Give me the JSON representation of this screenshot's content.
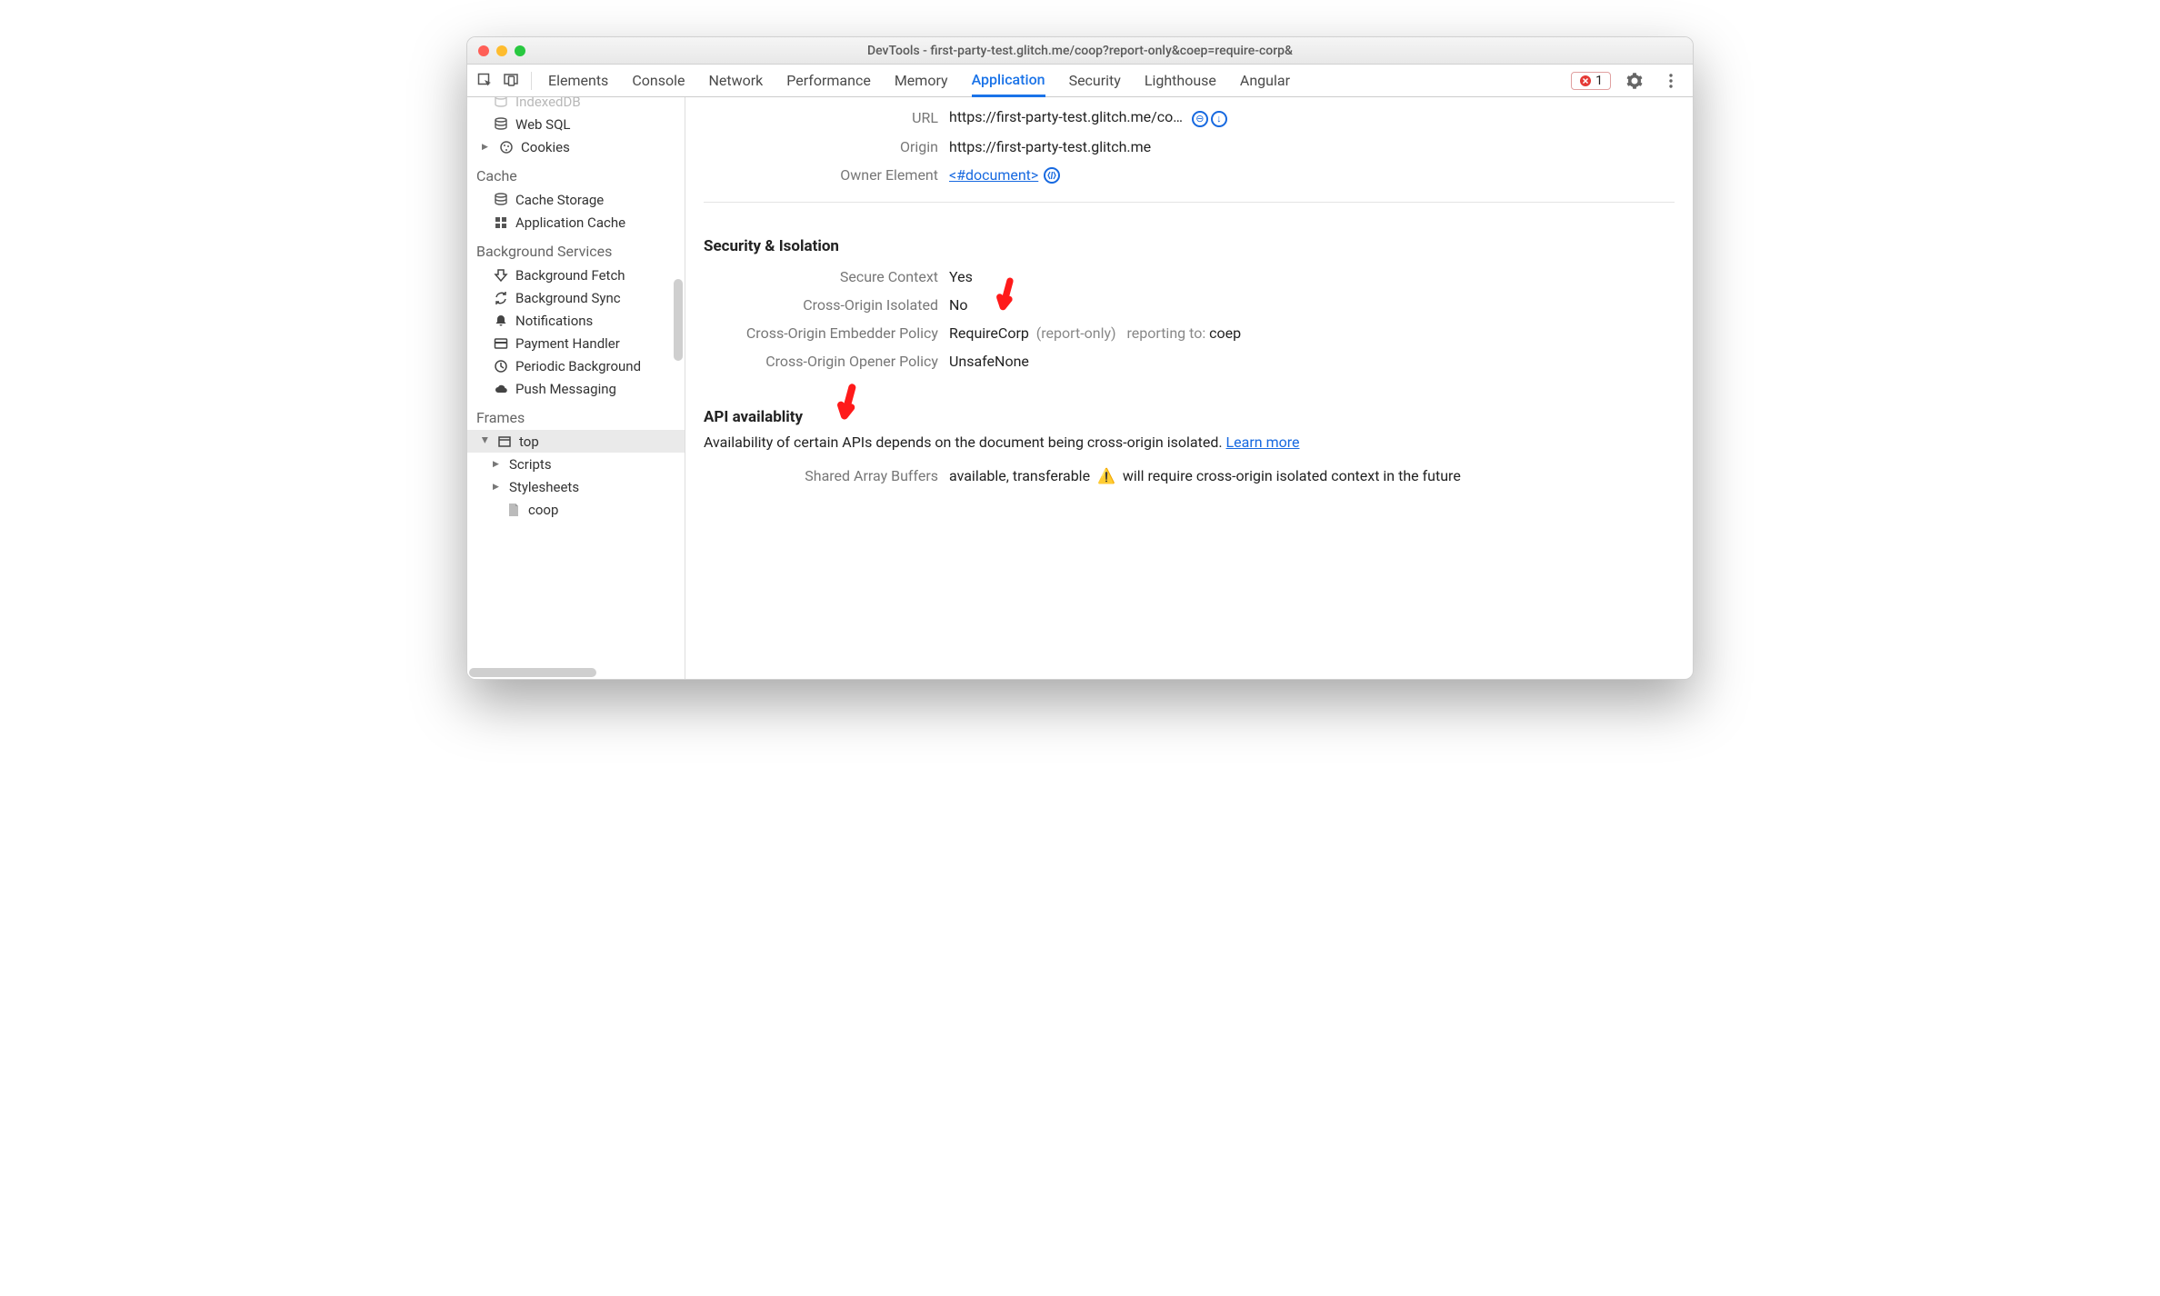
{
  "window": {
    "title": "DevTools - first-party-test.glitch.me/coop?report-only&coep=require-corp&"
  },
  "tabs": {
    "items": [
      "Elements",
      "Console",
      "Network",
      "Performance",
      "Memory",
      "Application",
      "Security",
      "Lighthouse",
      "Angular"
    ],
    "active": "Application"
  },
  "error_count": "1",
  "sidebar": {
    "indexeddb": "IndexedDB",
    "websql": "Web SQL",
    "cookies": "Cookies",
    "cache_header": "Cache",
    "cache_storage": "Cache Storage",
    "app_cache": "Application Cache",
    "bg_header": "Background Services",
    "bg_fetch": "Background Fetch",
    "bg_sync": "Background Sync",
    "notif": "Notifications",
    "payment": "Payment Handler",
    "periodic": "Periodic Background",
    "push": "Push Messaging",
    "frames_header": "Frames",
    "top": "top",
    "scripts": "Scripts",
    "stylesheets": "Stylesheets",
    "coop": "coop"
  },
  "main": {
    "url_label": "URL",
    "url_value": "https://first-party-test.glitch.me/co…",
    "origin_label": "Origin",
    "origin_value": "https://first-party-test.glitch.me",
    "owner_label": "Owner Element",
    "owner_value": "<#document>",
    "sec_heading": "Security & Isolation",
    "secure_ctx_label": "Secure Context",
    "secure_ctx_value": "Yes",
    "coi_label": "Cross-Origin Isolated",
    "coi_value": "No",
    "coep_label": "Cross-Origin Embedder Policy",
    "coep_value": "RequireCorp",
    "coep_report_only": "(report-only)",
    "coep_reporting_label": "reporting to:",
    "coep_reporting_value": "coep",
    "coop_label": "Cross-Origin Opener Policy",
    "coop_value": "UnsafeNone",
    "api_heading": "API availablity",
    "api_desc": "Availability of certain APIs depends on the document being cross-origin isolated. ",
    "learn_more": "Learn more",
    "sab_label": "Shared Array Buffers",
    "sab_value": "available, transferable",
    "sab_warn": "will require cross-origin isolated context in the future"
  }
}
